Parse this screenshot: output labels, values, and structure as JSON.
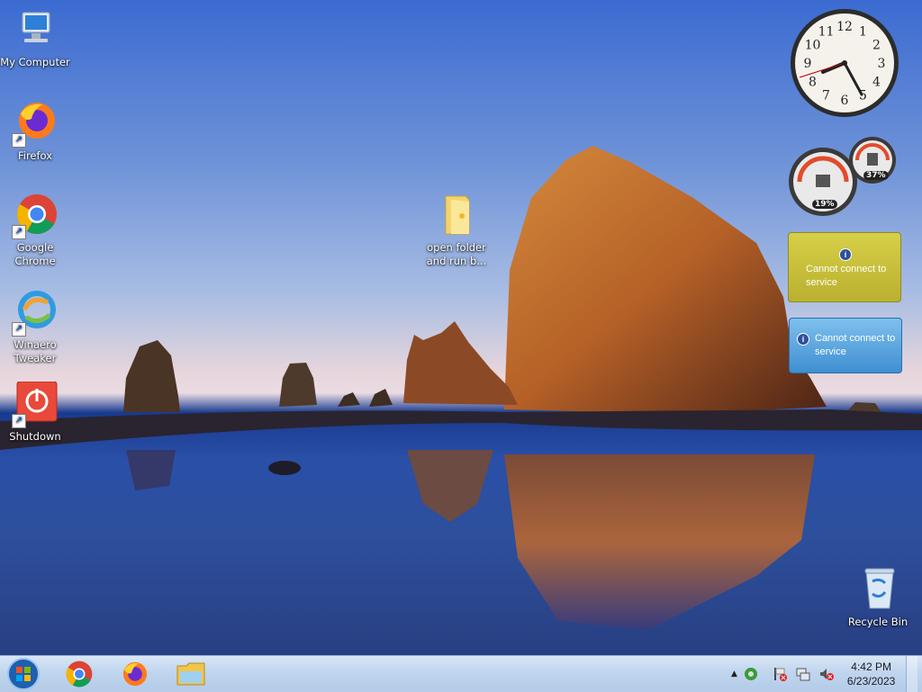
{
  "desktop": {
    "icons": [
      {
        "label": "My Computer"
      },
      {
        "label": "Firefox"
      },
      {
        "label": "Google Chrome"
      },
      {
        "label": "Winaero Tweaker"
      },
      {
        "label": "Shutdown"
      },
      {
        "label": "open folder and run b..."
      },
      {
        "label": "Recycle Bin"
      }
    ]
  },
  "gadgets": {
    "meter_cpu": "19%",
    "meter_ram": "37%",
    "weather_msg": "Cannot connect to service",
    "feed_msg": "Cannot connect to service",
    "clock_numbers": [
      "12",
      "1",
      "2",
      "3",
      "4",
      "5",
      "6",
      "7",
      "8",
      "9",
      "10",
      "11"
    ]
  },
  "taskbar": {
    "time": "4:42 PM",
    "date": "6/23/2023"
  },
  "colors": {
    "sky_top": "#3b6bd1",
    "water": "#2a4fa7",
    "taskbar": "#c0d5ee",
    "weather_gadget": "#c9c23c",
    "feed_gadget": "#4fa0dc"
  },
  "icons": [
    "computer-icon",
    "firefox-icon",
    "chrome-icon",
    "winaero-icon",
    "shutdown-icon",
    "folder-icon",
    "recycle-bin-icon",
    "start-orb-icon",
    "volume-muted-icon",
    "network-icon",
    "flag-icon"
  ]
}
